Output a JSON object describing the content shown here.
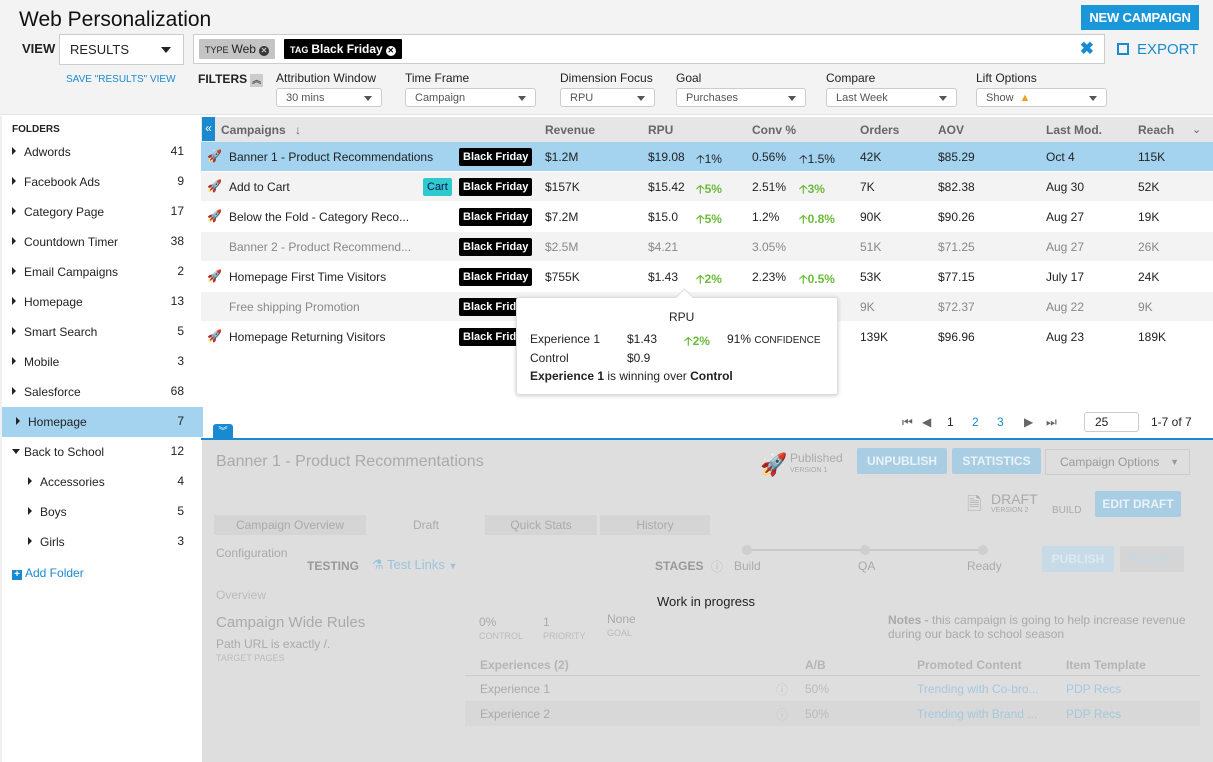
{
  "header": {
    "title": "Web Personalization",
    "new_campaign": "NEW CAMPAIGN",
    "view_label": "VIEW",
    "view_value": "RESULTS",
    "save_view": "SAVE \"RESULTS\" VIEW",
    "export": "EXPORT",
    "chips": [
      {
        "key": "TYPE",
        "value": "Web"
      },
      {
        "key": "TAG",
        "value": "Black Friday"
      }
    ],
    "filters_label": "FILTERS",
    "filters": [
      {
        "label": "Attribution Window",
        "value": "30 mins"
      },
      {
        "label": "Time Frame",
        "value": "Campaign"
      },
      {
        "label": "Dimension Focus",
        "value": "RPU"
      },
      {
        "label": "Goal",
        "value": "Purchases"
      },
      {
        "label": "Compare",
        "value": "Last Week"
      },
      {
        "label": "Lift Options",
        "value": "Show"
      }
    ]
  },
  "sidebar": {
    "title": "FOLDERS",
    "folders": [
      {
        "name": "Adwords",
        "count": "41"
      },
      {
        "name": "Facebook Ads",
        "count": "9"
      },
      {
        "name": "Category Page",
        "count": "17"
      },
      {
        "name": "Countdown Timer",
        "count": "38"
      },
      {
        "name": "Email Campaigns",
        "count": "2"
      },
      {
        "name": "Homepage",
        "count": "13"
      },
      {
        "name": "Smart Search",
        "count": "5"
      },
      {
        "name": "Mobile",
        "count": "3"
      },
      {
        "name": "Salesforce",
        "count": "68"
      },
      {
        "name": "Homepage",
        "count": "7"
      },
      {
        "name": "Back to School",
        "count": "12"
      },
      {
        "name": "Accessories",
        "count": "4"
      },
      {
        "name": "Boys",
        "count": "5"
      },
      {
        "name": "Girls",
        "count": "3"
      }
    ],
    "add_folder": "Add Folder"
  },
  "table": {
    "columns": [
      "Campaigns",
      "Revenue",
      "RPU",
      "Conv %",
      "Orders",
      "AOV",
      "Last Mod.",
      "Reach"
    ],
    "rows": [
      {
        "name": "Banner 1 -  Product Recommendations",
        "tag": "Black Friday",
        "revenue": "$1.2M",
        "rpu": "$19.08",
        "rpu_lift": "1%",
        "conv": "0.56%",
        "conv_lift": "1.5%",
        "orders": "42K",
        "aov": "$85.29",
        "last_mod": "Oct  4",
        "reach": "115K"
      },
      {
        "name": "Add to Cart",
        "extra_tag": "Cart",
        "tag": "Black Friday",
        "revenue": "$157K",
        "rpu": "$15.42",
        "rpu_lift": "5%",
        "conv": "2.51%",
        "conv_lift": "3%",
        "orders": "7K",
        "aov": "$82.38",
        "last_mod": "Aug 30",
        "reach": "52K"
      },
      {
        "name": "Below the Fold - Category Reco...",
        "tag": "Black Friday",
        "revenue": "$7.2M",
        "rpu": "$15.0",
        "rpu_lift": "5%",
        "conv": "1.2%",
        "conv_lift": "0.8%",
        "orders": "90K",
        "aov": "$90.26",
        "last_mod": "Aug 27",
        "reach": "19K"
      },
      {
        "name": "Banner 2 - Product Recommend...",
        "tag": "Black Friday",
        "revenue": "$2.5M",
        "rpu": "$4.21",
        "rpu_lift": "",
        "conv": "3.05%",
        "conv_lift": "",
        "orders": "51K",
        "aov": "$71.25",
        "last_mod": "Aug 27",
        "reach": "26K"
      },
      {
        "name": "Homepage First Time Visitors",
        "tag": "Black Friday",
        "revenue": "$755K",
        "rpu": "$1.43",
        "rpu_lift": "2%",
        "conv": "2.23%",
        "conv_lift": "0.5%",
        "orders": "53K",
        "aov": "$77.15",
        "last_mod": "July 17",
        "reach": "24K"
      },
      {
        "name": "Free shipping Promotion",
        "tag": "Black Frida",
        "revenue": "",
        "rpu": "",
        "rpu_lift": "",
        "conv": "",
        "conv_lift": "",
        "orders": "9K",
        "aov": "$72.37",
        "last_mod": "Aug 22",
        "reach": "9K"
      },
      {
        "name": "Homepage Returning Visitors",
        "tag": "Black Frida",
        "revenue": "",
        "rpu": "",
        "rpu_lift": "",
        "conv": "",
        "conv_lift": "",
        "orders": "139K",
        "aov": "$96.96",
        "last_mod": "Aug 23",
        "reach": "189K"
      }
    ]
  },
  "tooltip": {
    "title": "RPU",
    "exp_label": "Experience 1",
    "exp_value": "$1.43",
    "exp_lift": "2%",
    "confidence_value": "91%",
    "confidence_label": "CONFIDENCE",
    "control_label": "Control",
    "control_value": "$0.9",
    "winner": "Experience 1",
    "winner_text": " is winning over ",
    "loser": "Control"
  },
  "pager": {
    "pages": [
      "1",
      "2",
      "3"
    ],
    "page_size": "25",
    "summary": "1-7 of 7"
  },
  "detail": {
    "title": "Banner 1 - Product Recommentations",
    "published": "Published",
    "published_version": "VERSION 1",
    "unpublish": "UNPUBLISH",
    "statistics": "STATISTICS",
    "campaign_options": "Campaign Options",
    "draft": "DRAFT",
    "draft_version": "VERSION 2",
    "build": "BUILD",
    "edit_draft": "EDIT DRAFT",
    "tabs": [
      "Campaign Overview",
      "Draft",
      "Quick Stats",
      "History"
    ],
    "configuration": "Configuration",
    "testing": "TESTING",
    "test_links": "Test Links",
    "stages_label": "STAGES",
    "stages": [
      "Build",
      "QA",
      "Ready"
    ],
    "publish": "PUBLISH",
    "revert": "REVERT",
    "overview": "Overview",
    "work_in_progress": "Work in progress",
    "rules_title": "Campaign Wide Rules",
    "rules_text": "Path URL is exactly /.",
    "rules_sub": "TARGET  PAGES",
    "stats": [
      {
        "value": "0%",
        "label": "CONTROL"
      },
      {
        "value": "1",
        "label": "PRIORITY"
      },
      {
        "value": "None",
        "label": "GOAL"
      }
    ],
    "notes_label": "Notes -",
    "notes_text": " this campaign is going to help increase revenue",
    "notes_text2": "during our back to school season",
    "exp_columns": [
      "Experiences (2)",
      "A/B",
      "Promoted Content",
      "Item Template"
    ],
    "experiences": [
      {
        "name": "Experience 1",
        "ab": "50%",
        "content": "Trending with Co-bro...",
        "template": "PDP Recs"
      },
      {
        "name": "Experience 2",
        "ab": "50%",
        "content": "Trending with Brand ...",
        "template": "PDP Recs"
      }
    ]
  }
}
